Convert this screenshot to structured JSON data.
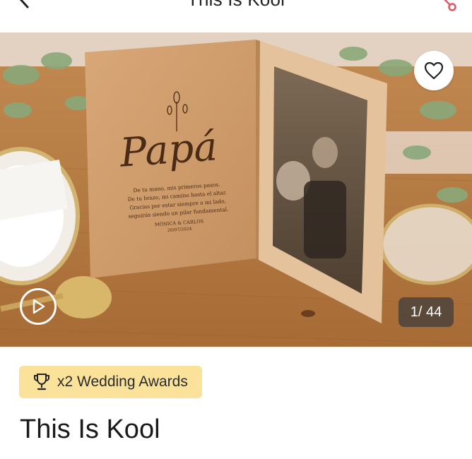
{
  "header": {
    "title": "This Is Kool"
  },
  "gallery": {
    "counter": "1/ 44",
    "plaque": {
      "name_script": "Papá",
      "lines": [
        "De tu mano, mis primeros pasos.",
        "De tu brazo, mi camino hasta el altar.",
        "Gracias por estar siempre a mi lado,",
        "seguirás siendo un pilar fundamental."
      ],
      "signature": "MÓNICA & CARLOS",
      "date": "20/07/2024"
    }
  },
  "badge": {
    "label": "x2 Wedding Awards",
    "color": "#fbe29a"
  },
  "listing": {
    "title": "This Is Kool"
  },
  "icons": [
    "back-arrow-icon",
    "share-icon",
    "heart-icon",
    "play-icon",
    "trophy-icon"
  ]
}
